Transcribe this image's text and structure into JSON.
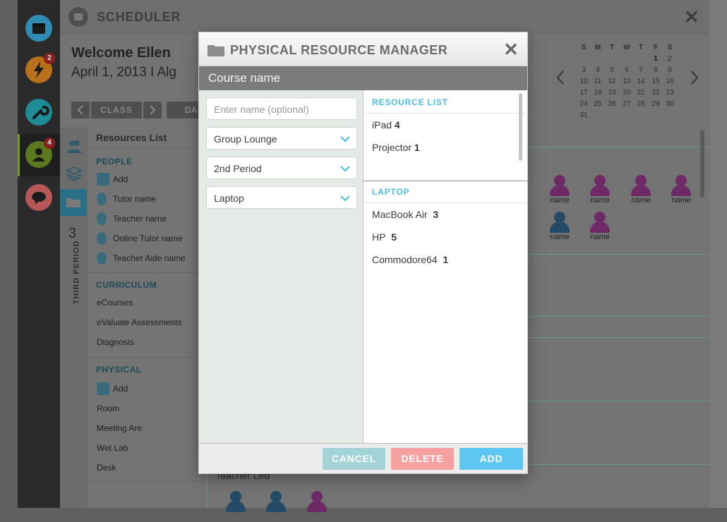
{
  "rail": {
    "icons": [
      "calendar-icon",
      "lightning-icon",
      "wrench-icon",
      "user-icon",
      "chat-icon"
    ],
    "badges": {
      "lightning": "2",
      "user": "4"
    }
  },
  "background": {
    "app_title": "SCHEDULER",
    "welcome": "Welcome Ellen",
    "date_line": "April 1, 2013  I  Alg",
    "class_label": "CLASS",
    "day_label": "DA",
    "resources_title": "Resources List",
    "period_number": "3",
    "period_label": "THIRD PERIOD",
    "people_header": "PEOPLE",
    "people_items": [
      "Add",
      "Tutor name",
      "Teacher name",
      "Online Tutor name",
      "Teacher Aide name"
    ],
    "curriculum_header": "CURRICULUM",
    "curriculum_items": [
      "eCourses",
      "eValuate Assessments",
      "Diagnosis"
    ],
    "physical_header": "PHYSICAL",
    "physical_items": [
      "Add",
      "Room",
      "Meeting Are",
      "Wet Lab",
      "Desk"
    ],
    "teacher_led": "Teacher Led",
    "person_name": "name"
  },
  "calendar": {
    "weekdays": [
      "S",
      "M",
      "T",
      "W",
      "T",
      "F",
      "S"
    ],
    "weeks": [
      [
        "",
        "",
        "",
        "",
        "",
        "1",
        "2"
      ],
      [
        "3",
        "4",
        "5",
        "6",
        "7",
        "8",
        "9"
      ],
      [
        "10",
        "11",
        "12",
        "13",
        "14",
        "15",
        "16"
      ],
      [
        "17",
        "18",
        "19",
        "20",
        "21",
        "22",
        "23"
      ],
      [
        "24",
        "25",
        "26",
        "27",
        "28",
        "29",
        "30"
      ],
      [
        "31",
        "",
        "",
        "",
        "",
        "",
        ""
      ]
    ]
  },
  "modal": {
    "title": "PHYSICAL RESOURCE MANAGER",
    "course_name": "Course name",
    "name_input": {
      "placeholder": "Enter name (optional)",
      "value": ""
    },
    "dropdowns": [
      "Group Lounge",
      "2nd Period",
      "Laptop"
    ],
    "resource_list_header": "RESOURCE LIST",
    "resource_list": [
      {
        "name": "iPad",
        "count": "4"
      },
      {
        "name": "Projector",
        "count": "1"
      }
    ],
    "laptop_header": "LAPTOP",
    "laptops": [
      {
        "name": "MacBook Air",
        "count": "3"
      },
      {
        "name": "HP",
        "count": "5"
      },
      {
        "name": "Commodore64",
        "count": "1"
      }
    ],
    "buttons": {
      "cancel": "CANCEL",
      "delete": "DELETE",
      "add": "ADD"
    },
    "colors": {
      "accent": "#4bbfe0",
      "cancel": "#a3d3d6",
      "delete": "#f7a0a0",
      "add": "#5cc8f2"
    }
  }
}
